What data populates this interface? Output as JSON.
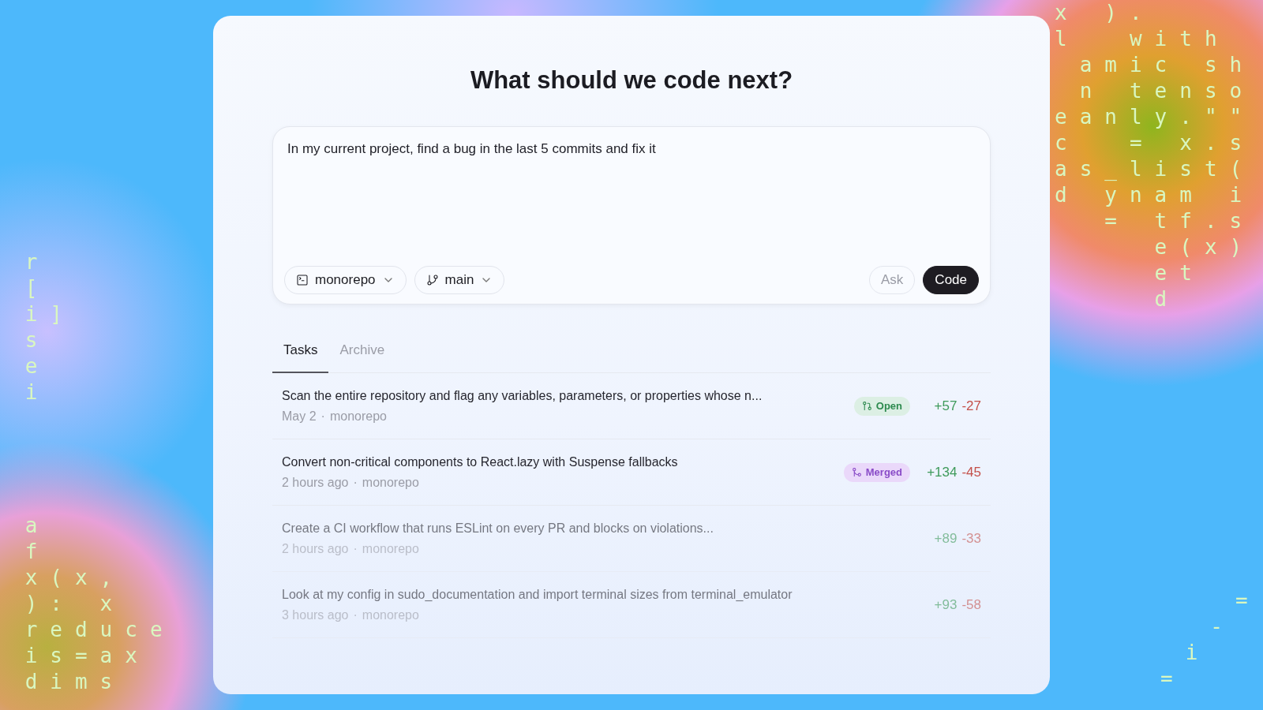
{
  "background_code": {
    "left_top": [
      " r",
      " [",
      " i]",
      " s",
      " e",
      " i"
    ],
    "left_bottom": [
      " a",
      " f",
      " x(x,",
      " ): x",
      " reduce",
      " is=ax",
      " dims"
    ],
    "right_top": [
      "x ).",
      "l  with",
      " amic sh",
      " n tenso",
      "eanly.\"\"",
      "c  = x.s",
      "as_list(",
      "d ynam i",
      "  = tf.s",
      "    e(x)",
      "    et",
      "    d"
    ],
    "right_bottom": [
      "   =",
      "  -",
      " i",
      "="
    ]
  },
  "title": "What should we code next?",
  "prompt": {
    "value": "In my current project, find a bug in the last 5 commits and fix it"
  },
  "repo_selector": {
    "label": "monorepo"
  },
  "branch_selector": {
    "label": "main"
  },
  "buttons": [
    {
      "label": "Ask",
      "kind": "secondary"
    },
    {
      "label": "Code",
      "kind": "primary"
    }
  ],
  "tabs": [
    {
      "label": "Tasks",
      "selected": true
    },
    {
      "label": "Archive",
      "selected": false
    }
  ],
  "tasks": [
    {
      "title": "Scan the entire repository and flag any variables, parameters, or properties whose n...",
      "time": "May 2",
      "separator": "·",
      "repo": "monorepo",
      "status": {
        "label": "Open",
        "kind": "open"
      },
      "added": "+57",
      "removed": "-27",
      "dimmed": false
    },
    {
      "title": "Convert non-critical components to React.lazy with Suspense fallbacks",
      "time": "2 hours ago",
      "separator": "·",
      "repo": "monorepo",
      "status": {
        "label": "Merged",
        "kind": "merged"
      },
      "added": "+134",
      "removed": "-45",
      "dimmed": false
    },
    {
      "title": "Create a CI workflow that runs ESLint on every PR and blocks on violations...",
      "time": "2 hours ago",
      "separator": "·",
      "repo": "monorepo",
      "added": "+89",
      "removed": "-33",
      "dimmed": true
    },
    {
      "title": "Look at my config in sudo_documentation and import terminal sizes from terminal_emulator",
      "time": "3 hours ago",
      "separator": "·",
      "repo": "monorepo",
      "added": "+93",
      "removed": "-58",
      "dimmed": true
    }
  ]
}
